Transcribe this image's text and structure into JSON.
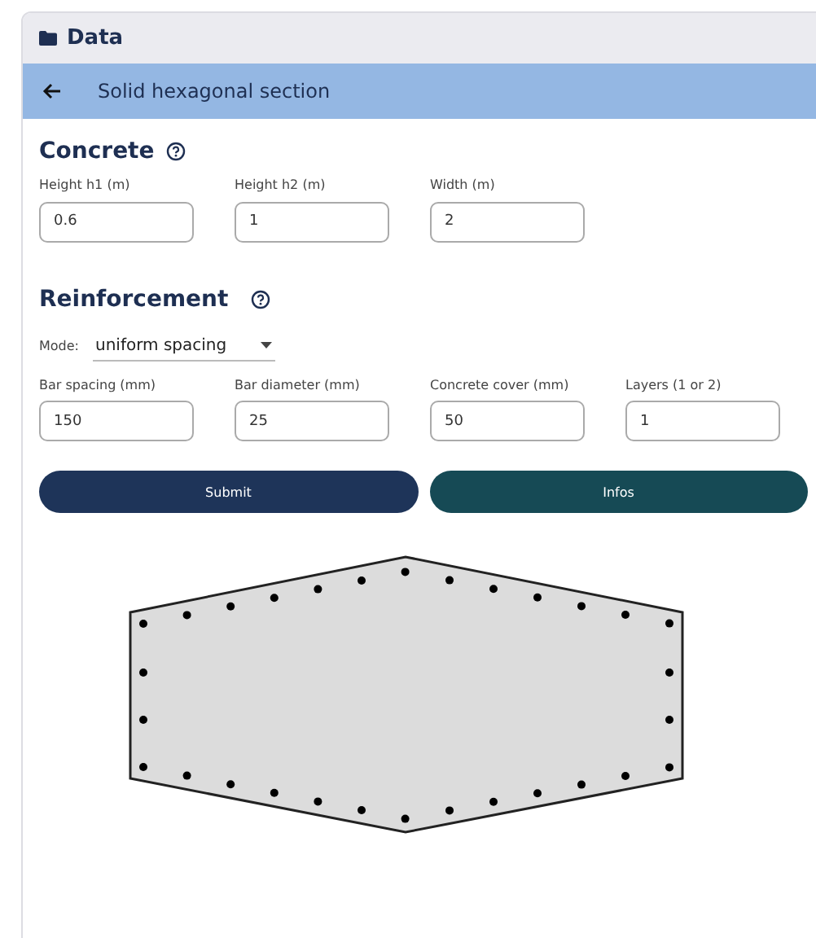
{
  "panel": {
    "title": "Data"
  },
  "subheader": {
    "title": "Solid hexagonal section"
  },
  "concrete": {
    "title": "Concrete",
    "fields": [
      {
        "label": "Height h1 (m)",
        "value": "0.6"
      },
      {
        "label": "Height h2 (m)",
        "value": "1"
      },
      {
        "label": "Width (m)",
        "value": "2"
      }
    ]
  },
  "reinforcement": {
    "title": "Reinforcement",
    "mode": {
      "label": "Mode:",
      "value": "uniform spacing"
    },
    "fields": [
      {
        "label": "Bar spacing (mm)",
        "value": "150"
      },
      {
        "label": "Bar diameter (mm)",
        "value": "25"
      },
      {
        "label": "Concrete cover (mm)",
        "value": "50"
      },
      {
        "label": "Layers (1 or 2)",
        "value": "1"
      }
    ]
  },
  "buttons": [
    {
      "label": "Submit",
      "kind": "primary"
    },
    {
      "label": "Infos",
      "kind": "secondary"
    }
  ],
  "section": {
    "kind": "hexagon"
  }
}
